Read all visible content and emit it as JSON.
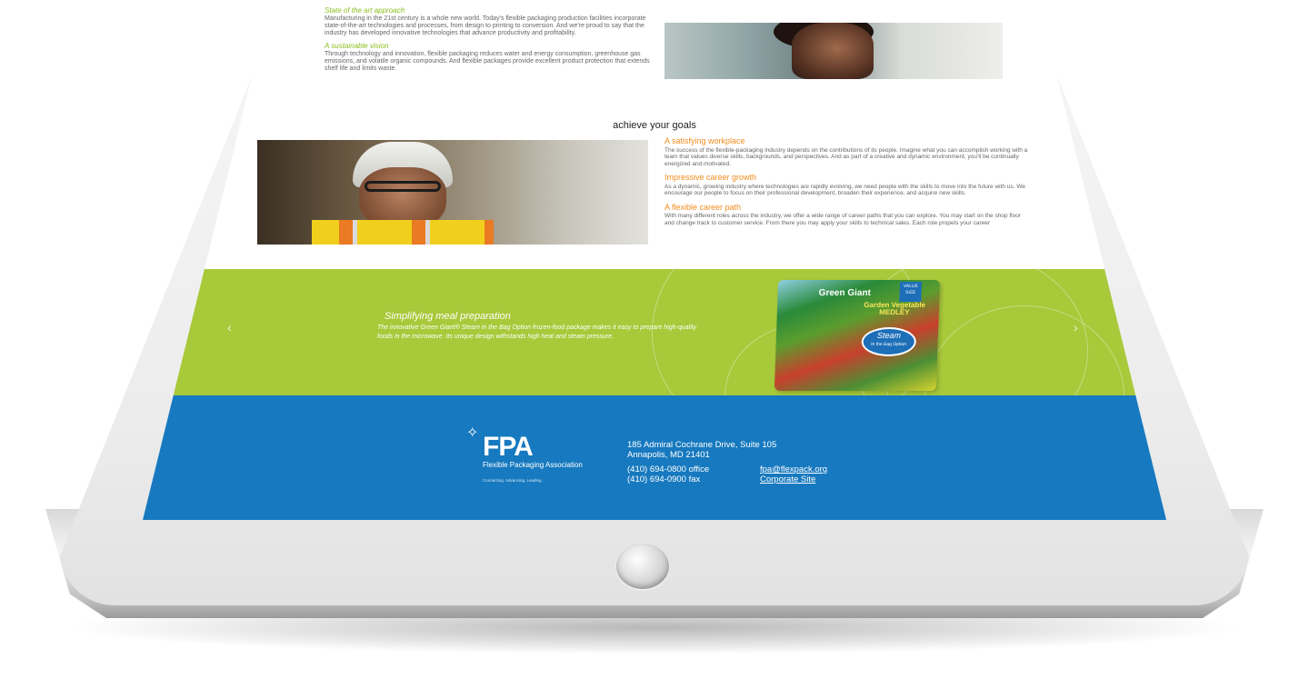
{
  "top_section": {
    "items": [
      {
        "title": "State of the art approach",
        "body": "Manufacturing in the 21st century is a whole new world. Today’s flexible packaging production facilities incorporate state-of-the-art technologies and processes, from design to printing to conversion. And we’re proud to say that the industry has developed innovative technologies that advance productivity and profitability."
      },
      {
        "title": "A sustainable vision",
        "body": "Through technology and innovation, flexible packaging reduces water and energy consumption, greenhouse gas emissions, and volatile organic compounds. And flexible packages provide excellent product protection that extends shelf life and limits waste."
      }
    ]
  },
  "goals": {
    "heading": "achieve your goals",
    "items": [
      {
        "title": "A satisfying workplace",
        "body": "The success of the flexible-packaging industry depends on the contributions of its people. Imagine what you can accomplish working with a team that values diverse skills, backgrounds, and perspectives. And as part of a creative and dynamic environment, you’ll be continually energized and motivated."
      },
      {
        "title": "Impressive career growth",
        "body": "As a dynamic, growing industry where technologies are rapidly evolving, we need people with the skills to move into the future with us. We encourage our people to focus on their professional development, broaden their experience, and acquire new skills."
      },
      {
        "title": "A flexible career path",
        "body": "With many different roles across the industry, we offer a wide range of career paths that you can explore. You may start on the shop floor and change track to customer service. From there you may apply your skills to technical sales. Each role propels your career"
      }
    ]
  },
  "slider": {
    "title": "Simplifying meal preparation",
    "description": "The innovative Green Giant® Steam in the Bag Option frozen-food package makes it easy to prepare high-quality foods in the microwave. Its unique design withstands high heat and steam pressure.",
    "prev_arrow": "‹",
    "next_arrow": "›",
    "product": {
      "brand": "Green Giant",
      "name": "Garden Vegetable MEDLEY",
      "badge": "Steam",
      "badge_sub": "In the Bag Option",
      "value_tag": "VALUE SIZE"
    },
    "band_color": "#a8c93a"
  },
  "footer": {
    "logo_mark": "✧",
    "logo_text": "FPA",
    "org_name": "Flexible Packaging Association",
    "tagline": "Connecting. Advancing. Leading.",
    "address_line1": "185 Admiral Cochrane Drive, Suite 105",
    "address_line2": "Annapolis, MD 21401",
    "phone_office": "(410) 694-0800 office",
    "phone_fax": "(410) 694-0900 fax",
    "email": "fpa@flexpack.org",
    "corporate_link": "Corporate Site",
    "band_color": "#1779bf"
  },
  "colors": {
    "accent_green": "#8cbf1f",
    "accent_orange": "#f28c1e"
  }
}
